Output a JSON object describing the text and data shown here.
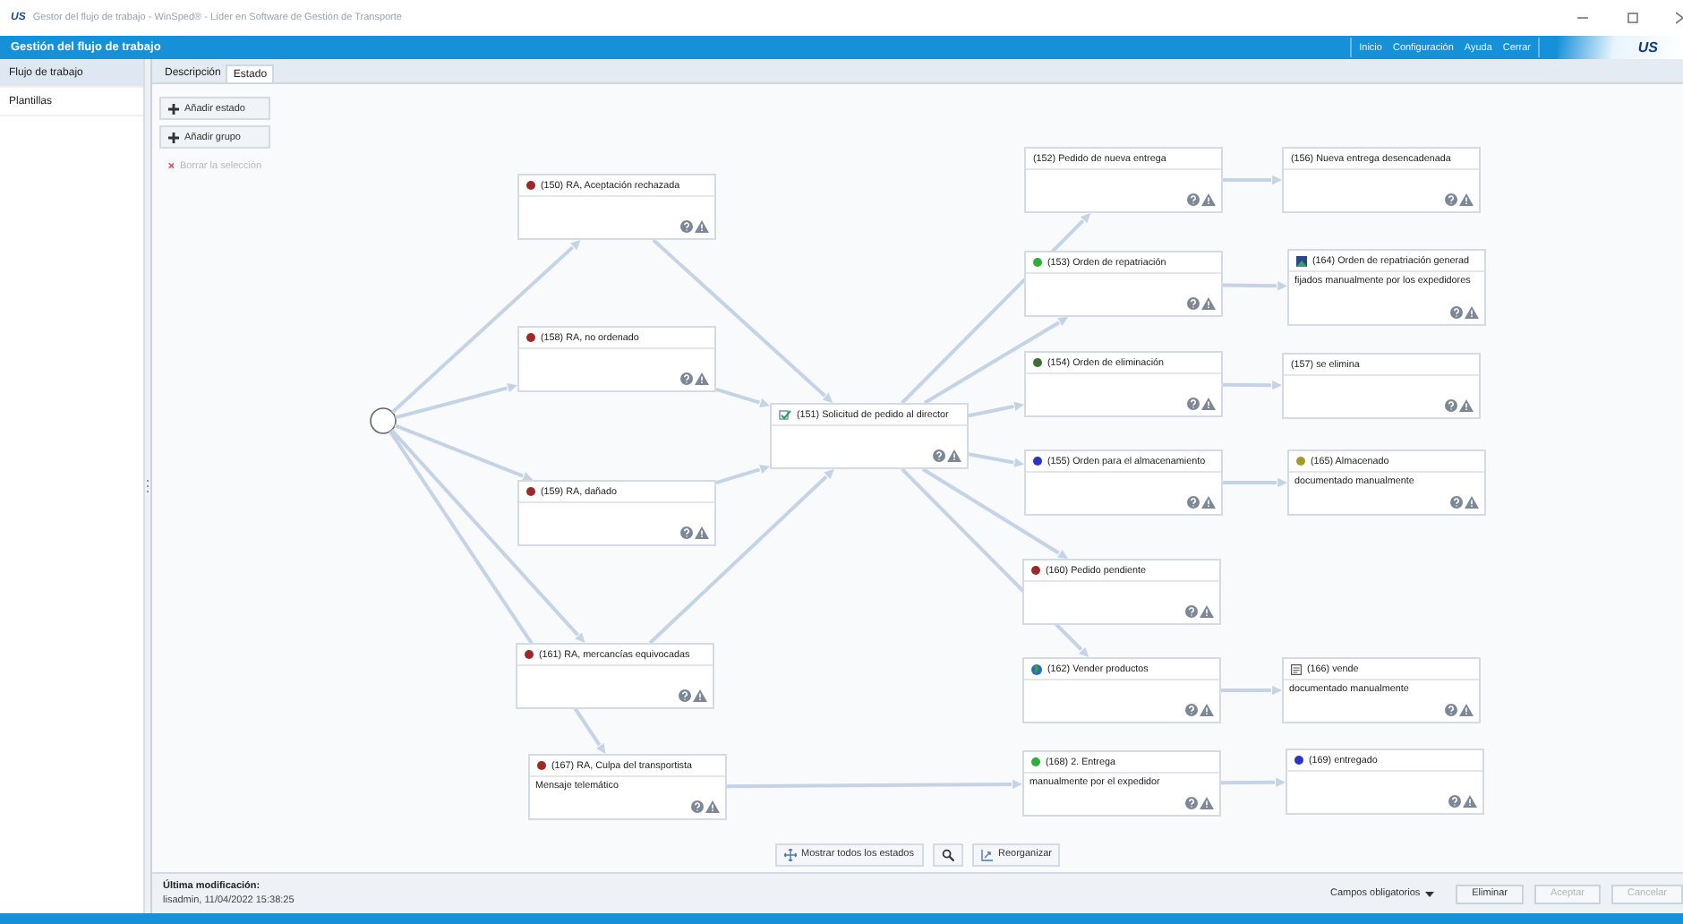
{
  "window": {
    "logo": "US",
    "title": "Gestor del flujo de trabajo - WinSped® - Líder en Software de Gestión de Transporte"
  },
  "header": {
    "title": "Gestión del flujo de trabajo",
    "menu": [
      "Inicio",
      "Configuración",
      "Ayuda",
      "Cerrar"
    ],
    "logo": "US"
  },
  "sidebar": {
    "items": [
      {
        "label": "Flujo de trabajo",
        "selected": true
      },
      {
        "label": "Plantillas",
        "selected": false
      }
    ]
  },
  "tabs": [
    {
      "label": "Descripción",
      "selected": false
    },
    {
      "label": "Estado",
      "selected": true
    }
  ],
  "actions": [
    {
      "kind": "add",
      "label": "Añadir estado",
      "disabled": false
    },
    {
      "kind": "add",
      "label": "Añadir grupo",
      "disabled": false
    },
    {
      "kind": "delete",
      "label": "Borrar la selección",
      "disabled": true
    }
  ],
  "nodes": [
    {
      "kind": "dot",
      "color": "#9c2a2a",
      "title": "(150) RA, Aceptación rechazada"
    },
    {
      "kind": "dot",
      "color": "#9c2a2a",
      "title": "(158) RA, no ordenado"
    },
    {
      "kind": "dot",
      "color": "#9c2a2a",
      "title": "(159) RA, dañado"
    },
    {
      "kind": "dot",
      "color": "#9c2a2a",
      "title": "(161) RA, mercancías equivocadas"
    },
    {
      "kind": "dot",
      "color": "#9c2a2a",
      "title": "(167) RA, Culpa del transportista",
      "note": "Mensaje telemático"
    },
    {
      "kind": "check",
      "title": "(151) Solicitud de pedido al director"
    },
    {
      "kind": "plain",
      "title": "(152) Pedido de nueva entrega"
    },
    {
      "kind": "plain",
      "title": "(156) Nueva entrega desencadenada"
    },
    {
      "kind": "dot",
      "color": "#2fae3c",
      "title": "(153) Orden de repatriación"
    },
    {
      "kind": "image",
      "title": "(164) Orden de repatriación generad",
      "note": "fijados manualmente por los expedidores"
    },
    {
      "kind": "dot",
      "color": "#3f6e3a",
      "title": "(154) Orden de eliminación"
    },
    {
      "kind": "plain",
      "title": "(157) se elimina"
    },
    {
      "kind": "dot",
      "color": "#2b34c4",
      "title": "(155) Orden para el almacenamiento"
    },
    {
      "kind": "dot",
      "color": "#a39a2c",
      "title": "(165) Almacenado",
      "note": "documentado manualmente"
    },
    {
      "kind": "dot",
      "color": "#9c2a2a",
      "title": "(160) Pedido pendiente"
    },
    {
      "kind": "globe",
      "title": "(162) Vender productos"
    },
    {
      "kind": "note",
      "title": "(166) vende",
      "note": "documentado manualmente"
    },
    {
      "kind": "dot",
      "color": "#2fae3c",
      "title": "(168) 2. Entrega",
      "note": "manualmente por el expedidor"
    },
    {
      "kind": "dot",
      "color": "#2b34c4",
      "title": "(169) entregado"
    }
  ],
  "toolbar": [
    {
      "kind": "show-all",
      "label": "Mostrar todos los estados"
    },
    {
      "kind": "search"
    },
    {
      "kind": "arrange",
      "label": "Reorganizar"
    }
  ],
  "footer": {
    "modified_label": "Última modificación:",
    "modified_value": "lisadmin, 11/04/2022 15:38:25",
    "buttons": [
      {
        "kind": "dropdown",
        "label": "Campos obligatorios"
      },
      {
        "kind": "button",
        "label": "Eliminar",
        "disabled": false
      },
      {
        "kind": "button",
        "label": "Aceptar",
        "disabled": true
      },
      {
        "kind": "button",
        "label": "Cancelar",
        "disabled": true
      }
    ]
  }
}
